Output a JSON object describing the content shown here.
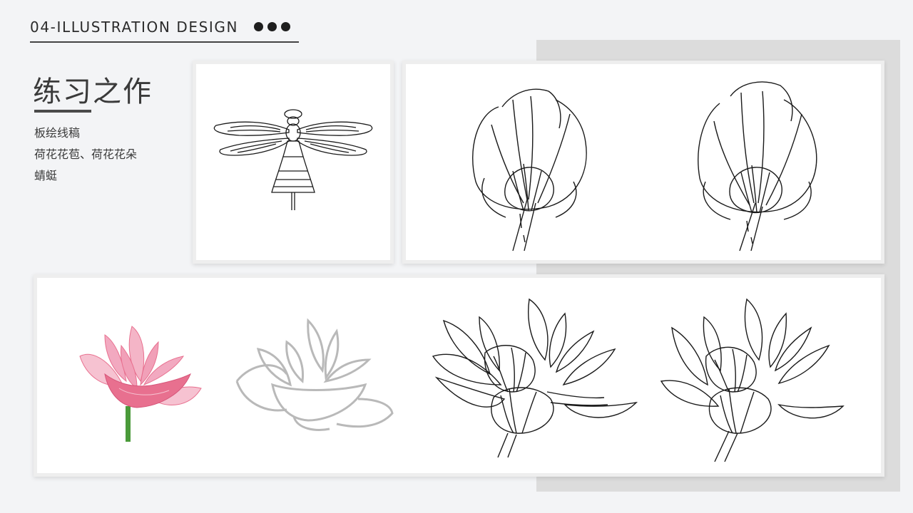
{
  "header": {
    "title": "04-ILLUSTRATION DESIGN"
  },
  "section": {
    "title": "练习之作",
    "lines": [
      "板绘线稿",
      "荷花花苞、荷花花朵",
      "蜻蜓"
    ]
  },
  "colors": {
    "lotus_pink": "#e8708f",
    "lotus_light": "#f6c2d1",
    "stem_green": "#4a9a3a",
    "sketch_gray": "#b9b9b9",
    "line_black": "#1a1a1a"
  }
}
